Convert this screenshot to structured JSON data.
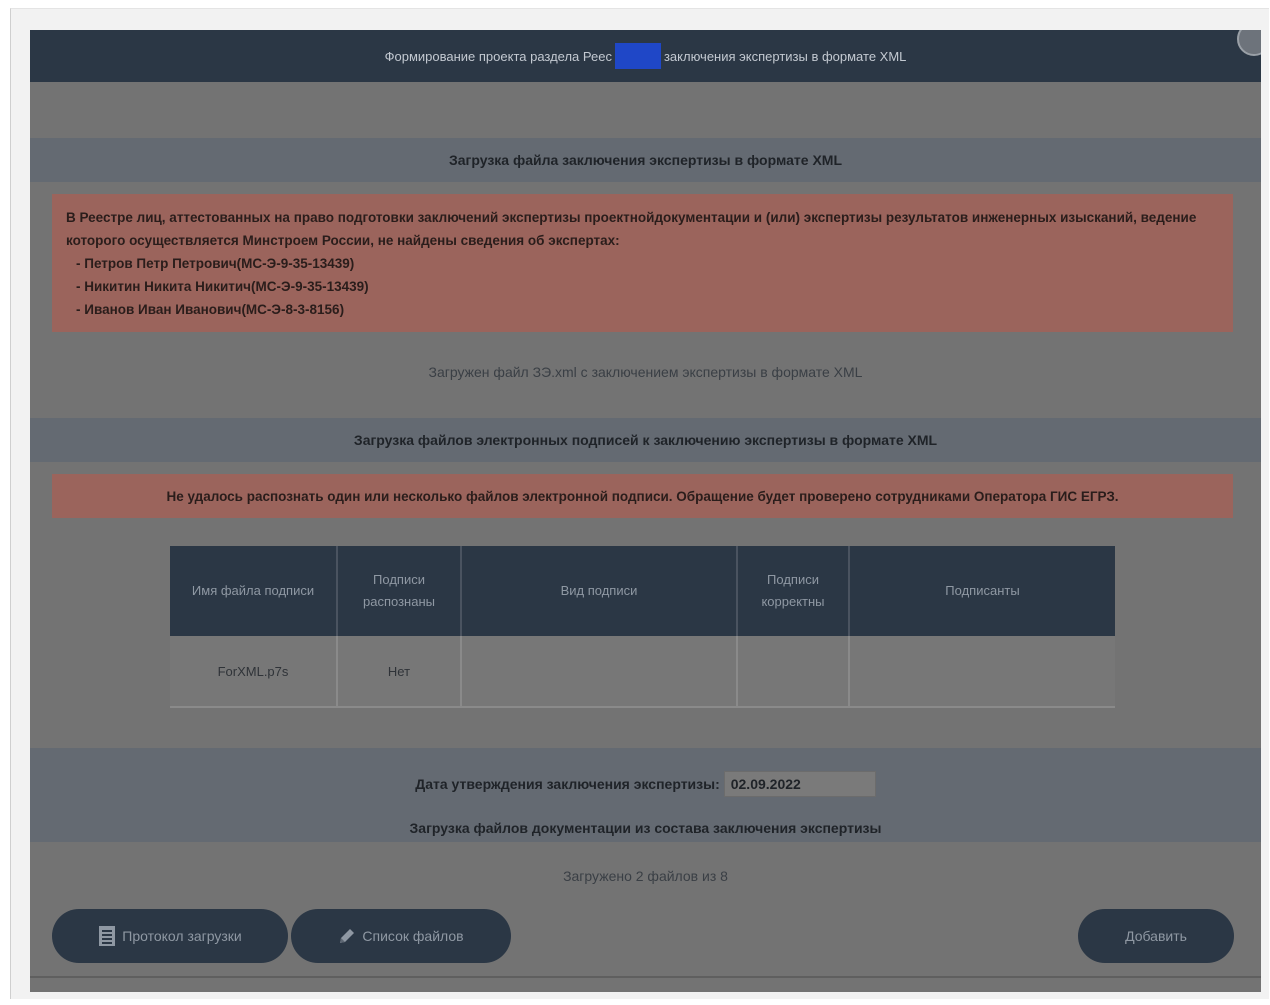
{
  "dialog": {
    "title_left": "Формирование проекта раздела Реес",
    "title_right": "заключения экспертизы в формате XML"
  },
  "conclusion_section": {
    "heading": "Загрузка файла заключения экспертизы в формате XML",
    "alert_text": "В Реестре лиц, аттестованных на право подготовки заключений экспертизы проектнойдокументации и (или) экспертизы результатов инженерных изысканий, ведение которого осуществляется Минстроем России, не найдены сведения об экспертах:",
    "experts": [
      "Петров Петр Петрович(МС-Э-9-35-13439)",
      "Никитин Никита Никитич(МС-Э-9-35-13439)",
      "Иванов Иван Иванович(МС-Э-8-3-8156)"
    ],
    "uploaded_text": "Загружен файл ЗЭ.xml с заключением экспертизы в формате XML"
  },
  "signatures_section": {
    "heading": "Загрузка файлов электронных подписей к заключению экспертизы в формате XML",
    "alert_text": "Не удалось распознать один или несколько файлов электронной подписи. Обращение будет проверено сотрудниками Оператора ГИС ЕГРЗ.",
    "table": {
      "headers": [
        "Имя файла подписи",
        "Подписи распознаны",
        "Вид подписи",
        "Подписи корректны",
        "Подписанты"
      ],
      "rows": [
        [
          "ForXML.p7s",
          "Нет",
          "",
          "",
          ""
        ]
      ]
    }
  },
  "approval": {
    "label": "Дата утверждения заключения экспертизы:",
    "date_value": "02.09.2022"
  },
  "documents_section": {
    "heading": "Загрузка файлов документации из состава заключения экспертизы",
    "status": "Загружено 2 файлов из 8"
  },
  "buttons": {
    "protocol": "Протокол загрузки",
    "file_list": "Список файлов",
    "add": "Добавить"
  },
  "icons": {
    "protocol": "document-list-icon",
    "file_list": "pencil-icon"
  }
}
